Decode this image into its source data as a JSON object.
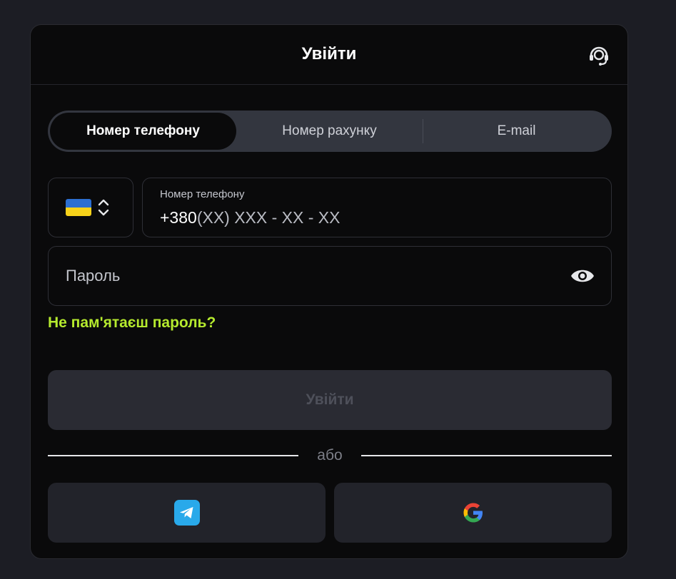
{
  "modal": {
    "title": "Увійти"
  },
  "tabs": [
    {
      "label": "Номер телефону",
      "active": true
    },
    {
      "label": "Номер рахунку",
      "active": false
    },
    {
      "label": "E-mail",
      "active": false
    }
  ],
  "country": {
    "flag": "ukraine-flag-icon",
    "chevron": "chevron-up-down-icon"
  },
  "phone": {
    "label": "Номер телефону",
    "prefix": "+380",
    "mask": "(XX) XXX - XX - XX"
  },
  "password": {
    "placeholder": "Пароль",
    "toggle_icon": "eye-icon"
  },
  "forgot_password": "Не пам'ятаєш пароль?",
  "login_button": "Увійти",
  "divider_text": "або",
  "social": {
    "telegram_icon": "telegram-icon",
    "google_icon": "google-icon"
  },
  "colors": {
    "background": "#1c1d24",
    "modal": "#0a0a0b",
    "accent_link": "#b5ea2e",
    "tab_track": "#33363f",
    "disabled_button": "#2a2b33"
  }
}
